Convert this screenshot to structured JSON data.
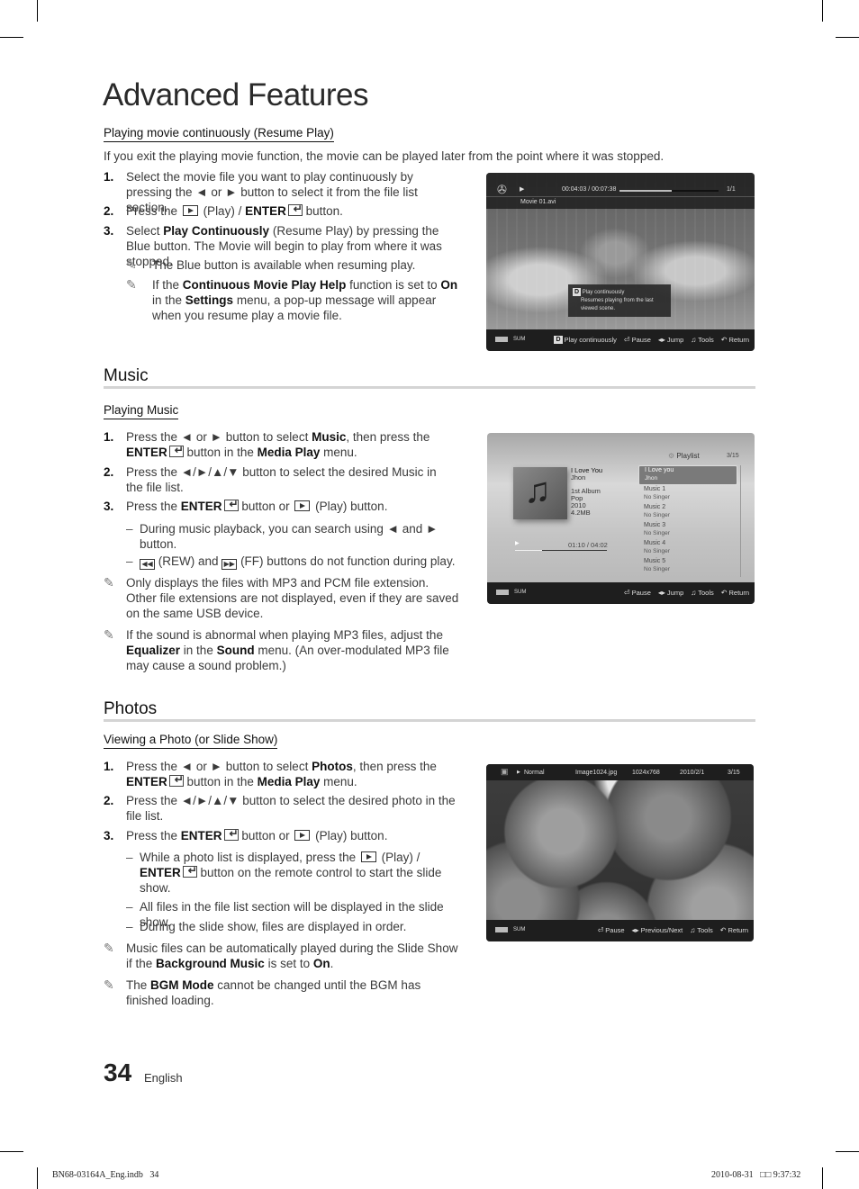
{
  "page": {
    "title": "Advanced Features",
    "page_number": "34",
    "language": "English",
    "footer_file": "BN68-03164A_Eng.indb   34",
    "footer_date": "2010-08-31   □□ 9:37:32"
  },
  "resume_play": {
    "heading": "Playing movie continuously (Resume Play)",
    "intro": "If you exit the playing movie function, the movie can be played later from the point where it was stopped.",
    "steps": [
      {
        "num": "1.",
        "text_a": "Select the movie file you want to play continuously by pressing the ◄ or ► button to select it from the file list section."
      },
      {
        "num": "2.",
        "text_a": "Press the",
        "text_b": "(Play) /",
        "bold_a": "ENTER",
        "text_c": "button."
      },
      {
        "num": "3.",
        "text_a": "Select",
        "bold_a": "Play Continuously",
        "text_b": "(Resume Play) by pressing the Blue button. The Movie will begin to play from where it was stopped."
      }
    ],
    "notes": [
      {
        "text": "The Blue button is available when resuming play."
      },
      {
        "text_a": "If the",
        "bold_a": "Continuous Movie Play Help",
        "text_b": "function is set to",
        "bold_b": "On",
        "text_c": "in the",
        "bold_c": "Settings",
        "text_d": "menu, a pop-up message will appear when you resume play a movie file."
      }
    ],
    "screen": {
      "time": "00:04:03 / 00:07:38",
      "progress": 0.53,
      "counter": "1/1",
      "filename": "Movie 01.avi",
      "popup_key": "D",
      "popup_title": "Play continuously",
      "popup_text": "Resumes playing from the last viewed scene.",
      "device": "SUM",
      "commands": [
        {
          "key": "D",
          "label": "Play continuously"
        },
        {
          "icon": "enter-icon",
          "label": "Pause"
        },
        {
          "icon": "left-right-icon",
          "label": "Jump"
        },
        {
          "icon": "tools-icon",
          "label": "Tools"
        },
        {
          "icon": "return-icon",
          "label": "Return"
        }
      ]
    }
  },
  "music": {
    "section_title": "Music",
    "heading": "Playing Music",
    "steps": [
      {
        "num": "1.",
        "text_a": "Press the ◄ or ► button to select",
        "bold_a": "Music",
        "text_b": ", then press the",
        "bold_b": "ENTER",
        "text_c": "button in the",
        "bold_c": "Media Play",
        "text_d": "menu."
      },
      {
        "num": "2.",
        "text_a": "Press the ◄/►/▲/▼ button to select the desired Music in the file list."
      },
      {
        "num": "3.",
        "text_a": "Press the",
        "bold_a": "ENTER",
        "text_b": "button or",
        "text_c": "(Play) button."
      }
    ],
    "dashes": [
      {
        "text": "During music playback, you can search using ◄ and ► button."
      },
      {
        "text_a": "(REW) and",
        "text_b": "(FF) buttons do not function during play."
      }
    ],
    "notes": [
      {
        "text": "Only displays the files with MP3 and PCM file extension. Other file extensions are not displayed, even if they are saved on the same USB device."
      },
      {
        "text_a": "If the sound is abnormal when playing MP3 files, adjust the",
        "bold_a": "Equalizer",
        "text_b": "in the",
        "bold_b": "Sound",
        "text_c": "menu. (An over-modulated MP3 file may cause a sound problem.)"
      }
    ],
    "screen": {
      "playlist_label": "Playlist",
      "playlist_counter": "3/15",
      "track_title": "I Love You",
      "artist": "Jhon",
      "album": "1st Album",
      "genre": "Pop",
      "year": "2010",
      "size": "4.2MB",
      "time": "01:10 / 04:02",
      "progress": 0.29,
      "playlist": [
        {
          "title": "I Love you",
          "artist": "Jhon",
          "selected": true
        },
        {
          "title": "Music 1",
          "artist": "No Singer"
        },
        {
          "title": "Music 2",
          "artist": "No Singer"
        },
        {
          "title": "Music 3",
          "artist": "No Singer"
        },
        {
          "title": "Music 4",
          "artist": "No Singer"
        },
        {
          "title": "Music 5",
          "artist": "No Singer"
        }
      ],
      "device": "SUM",
      "commands": [
        {
          "icon": "enter-icon",
          "label": "Pause"
        },
        {
          "icon": "left-right-icon",
          "label": "Jump"
        },
        {
          "icon": "tools-icon",
          "label": "Tools"
        },
        {
          "icon": "return-icon",
          "label": "Return"
        }
      ]
    }
  },
  "photos": {
    "section_title": "Photos",
    "heading": "Viewing a Photo (or Slide Show)",
    "steps": [
      {
        "num": "1.",
        "text_a": "Press the ◄ or ► button to select",
        "bold_a": "Photos",
        "text_b": ", then press the",
        "bold_b": "ENTER",
        "text_c": "button in the",
        "bold_c": "Media Play",
        "text_d": "menu."
      },
      {
        "num": "2.",
        "text_a": "Press the ◄/►/▲/▼ button to select the desired photo in the file list."
      },
      {
        "num": "3.",
        "text_a": "Press the",
        "bold_a": "ENTER",
        "text_b": "button or",
        "text_c": "(Play) button."
      }
    ],
    "dashes": [
      {
        "text_a": "While a photo list is displayed, press the",
        "text_b": "(Play) /",
        "bold_a": "ENTER",
        "text_c": "button on the remote control to start the slide show."
      },
      {
        "text": "All files in the file list section will be displayed in the slide show."
      },
      {
        "text": "During the slide show, files are displayed in order."
      }
    ],
    "notes": [
      {
        "text_a": "Music files can be automatically played during the Slide Show if the",
        "bold_a": "Background Music",
        "text_b": "is set to",
        "bold_b": "On",
        "text_c": "."
      },
      {
        "text_a": "The",
        "bold_a": "BGM Mode",
        "text_b": "cannot be changed until the BGM has finished loading."
      }
    ],
    "screen": {
      "mode": "Normal",
      "filename": "Image1024.jpg",
      "resolution": "1024x768",
      "date": "2010/2/1",
      "counter": "3/15",
      "device": "SUM",
      "commands": [
        {
          "icon": "enter-icon",
          "label": "Pause"
        },
        {
          "icon": "left-right-icon",
          "label": "Previous/Next"
        },
        {
          "icon": "tools-icon",
          "label": "Tools"
        },
        {
          "icon": "return-icon",
          "label": "Return"
        }
      ]
    }
  }
}
